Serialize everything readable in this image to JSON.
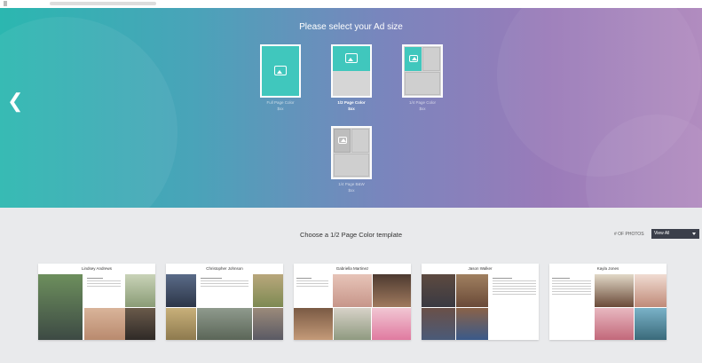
{
  "hero": {
    "title": "Please select your Ad size",
    "options": [
      {
        "label": "Full Page Color",
        "price": "$xx",
        "type": "full"
      },
      {
        "label": "1/2 Page Color",
        "price": "$xx",
        "type": "half"
      },
      {
        "label": "1/4 Page Color",
        "price": "$xx",
        "type": "quarter"
      },
      {
        "label": "1/4 Page B&W",
        "price": "$xx",
        "type": "quarter-bw"
      }
    ],
    "selected_index": 1
  },
  "templates": {
    "title": "Choose a 1/2 Page Color template",
    "photos_label": "# OF PHOTOS",
    "photos_value": "View All",
    "cards": [
      {
        "name": "Lindsey Andrews"
      },
      {
        "name": "Christopher Johnson"
      },
      {
        "name": "Gabriella Martinez"
      },
      {
        "name": "Jason Walker"
      },
      {
        "name": "Kayla Jones"
      }
    ]
  },
  "colors": {
    "accent": "#40c7bd",
    "select_bg": "#3b3f4a",
    "page_bg": "#e9eaec"
  },
  "icons": {
    "back": "chevron-left-icon",
    "image": "image-icon",
    "caret": "caret-down-icon"
  }
}
